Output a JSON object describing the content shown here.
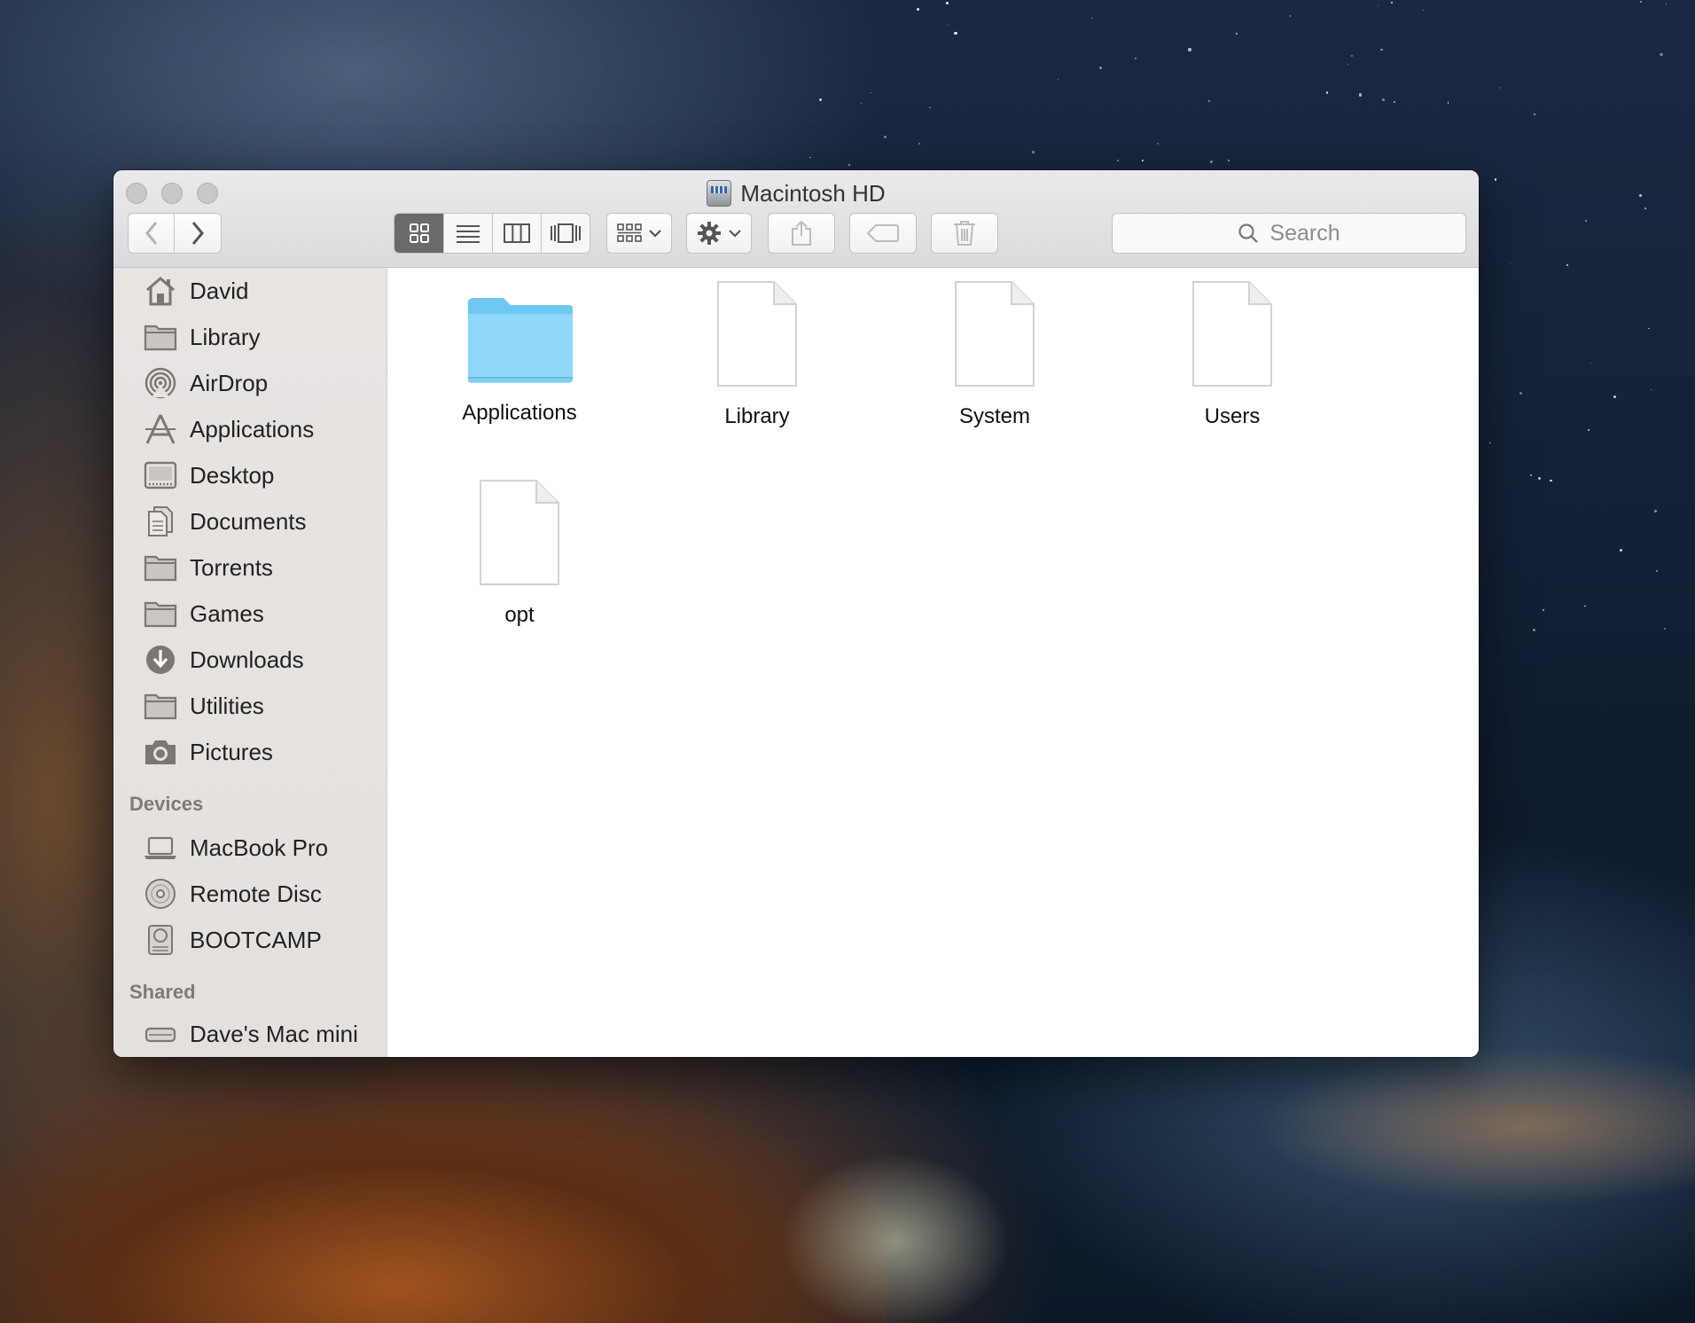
{
  "window": {
    "title": "Macintosh HD"
  },
  "toolbar": {
    "search_placeholder": "Search"
  },
  "sidebar": {
    "favorites": [
      {
        "label": "David",
        "icon": "home-icon"
      },
      {
        "label": "Library",
        "icon": "folder-icon"
      },
      {
        "label": "AirDrop",
        "icon": "airdrop-icon"
      },
      {
        "label": "Applications",
        "icon": "applications-icon"
      },
      {
        "label": "Desktop",
        "icon": "desktop-icon"
      },
      {
        "label": "Documents",
        "icon": "documents-icon"
      },
      {
        "label": "Torrents",
        "icon": "folder-icon"
      },
      {
        "label": "Games",
        "icon": "folder-icon"
      },
      {
        "label": "Downloads",
        "icon": "downloads-icon"
      },
      {
        "label": "Utilities",
        "icon": "folder-icon"
      },
      {
        "label": "Pictures",
        "icon": "camera-icon"
      }
    ],
    "devices_header": "Devices",
    "devices": [
      {
        "label": "MacBook Pro",
        "icon": "laptop-icon"
      },
      {
        "label": "Remote Disc",
        "icon": "disc-icon"
      },
      {
        "label": "BOOTCAMP",
        "icon": "hard-drive-icon"
      }
    ],
    "shared_header": "Shared",
    "shared": [
      {
        "label": "Dave's Mac mini",
        "icon": "mac-mini-icon"
      }
    ]
  },
  "content": {
    "items": [
      {
        "label": "Applications",
        "kind": "folder"
      },
      {
        "label": "Library",
        "kind": "document"
      },
      {
        "label": "System",
        "kind": "document"
      },
      {
        "label": "Users",
        "kind": "document"
      },
      {
        "label": "opt",
        "kind": "document"
      }
    ]
  },
  "colors": {
    "folder_blue": "#7fd0f5",
    "selected_segment": "#6b6a6b"
  }
}
